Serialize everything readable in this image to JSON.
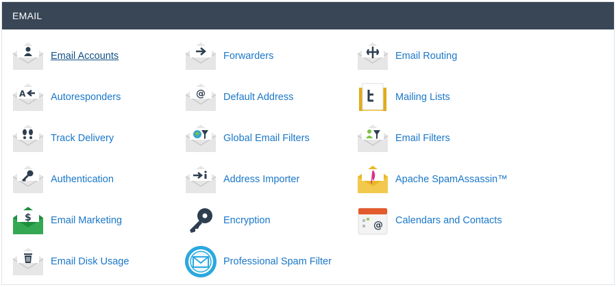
{
  "section": {
    "title": "EMAIL"
  },
  "items": [
    {
      "label": "Email Accounts",
      "icon": "email-accounts-icon"
    },
    {
      "label": "Forwarders",
      "icon": "forwarders-icon"
    },
    {
      "label": "Email Routing",
      "icon": "email-routing-icon"
    },
    {
      "label": "Autoresponders",
      "icon": "autoresponders-icon"
    },
    {
      "label": "Default Address",
      "icon": "default-address-icon"
    },
    {
      "label": "Mailing Lists",
      "icon": "mailing-lists-icon"
    },
    {
      "label": "Track Delivery",
      "icon": "track-delivery-icon"
    },
    {
      "label": "Global Email Filters",
      "icon": "global-email-filters-icon"
    },
    {
      "label": "Email Filters",
      "icon": "email-filters-icon"
    },
    {
      "label": "Authentication",
      "icon": "authentication-icon"
    },
    {
      "label": "Address Importer",
      "icon": "address-importer-icon"
    },
    {
      "label": "Apache SpamAssassin™",
      "icon": "spamassassin-icon"
    },
    {
      "label": "Email Marketing",
      "icon": "email-marketing-icon"
    },
    {
      "label": "Encryption",
      "icon": "encryption-key-icon"
    },
    {
      "label": "Calendars and Contacts",
      "icon": "calendars-contacts-icon"
    },
    {
      "label": "Email Disk Usage",
      "icon": "email-disk-usage-icon"
    },
    {
      "label": "Professional Spam Filter",
      "icon": "professional-spam-filter-icon"
    }
  ],
  "colors": {
    "header_bg": "#384656",
    "link": "#1a77c9",
    "envelope": "#e6e6e6"
  }
}
